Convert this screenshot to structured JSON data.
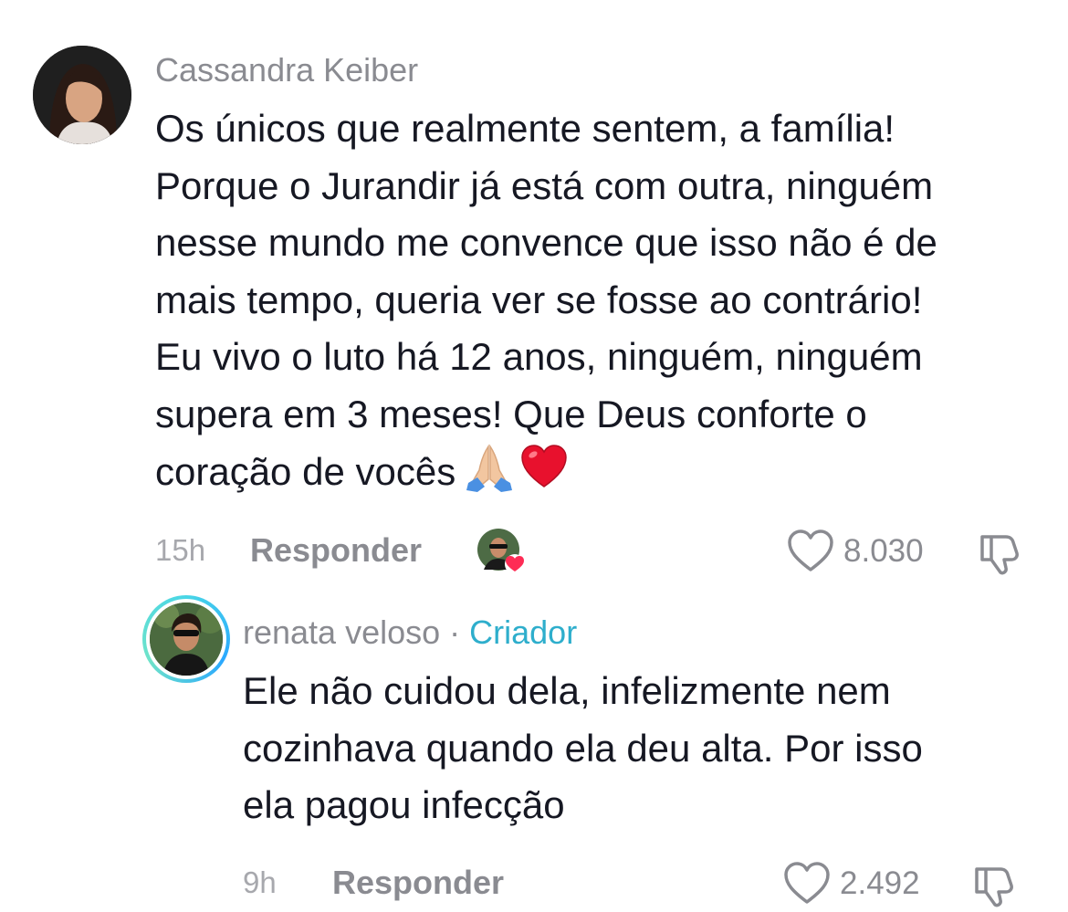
{
  "comments": [
    {
      "username": "Cassandra Keiber",
      "lines": [
        "Os únicos que realmente sentem, a família!",
        "Porque o Jurandir já está com outra, ninguém",
        "nesse mundo me convence que isso não é de",
        "mais tempo, queria ver se fosse ao contrário!",
        "Eu vivo o luto há 12 anos, ninguém, ninguém",
        "supera em 3 meses! Que Deus conforte o",
        "coração de vocês"
      ],
      "emojis": [
        "🙏🏼",
        "❤️"
      ],
      "time": "15h",
      "reply_label": "Responder",
      "likes": "8.030",
      "liked_by_creator": true
    },
    {
      "username": "renata veloso",
      "separator": "·",
      "badge": "Criador",
      "lines": [
        "Ele não cuidou dela, infelizmente nem",
        "cozinhava quando ela deu alta. Por isso",
        "ela pagou infecção"
      ],
      "time": "9h",
      "reply_label": "Responder",
      "likes": "2.492"
    }
  ],
  "colors": {
    "username": "#8a8b91",
    "creator_badge": "#2eaecc",
    "body": "#161823",
    "liked_heart": "#fe2c55"
  },
  "icons": {
    "like": "heart-outline-icon",
    "dislike": "thumbs-down-icon"
  }
}
